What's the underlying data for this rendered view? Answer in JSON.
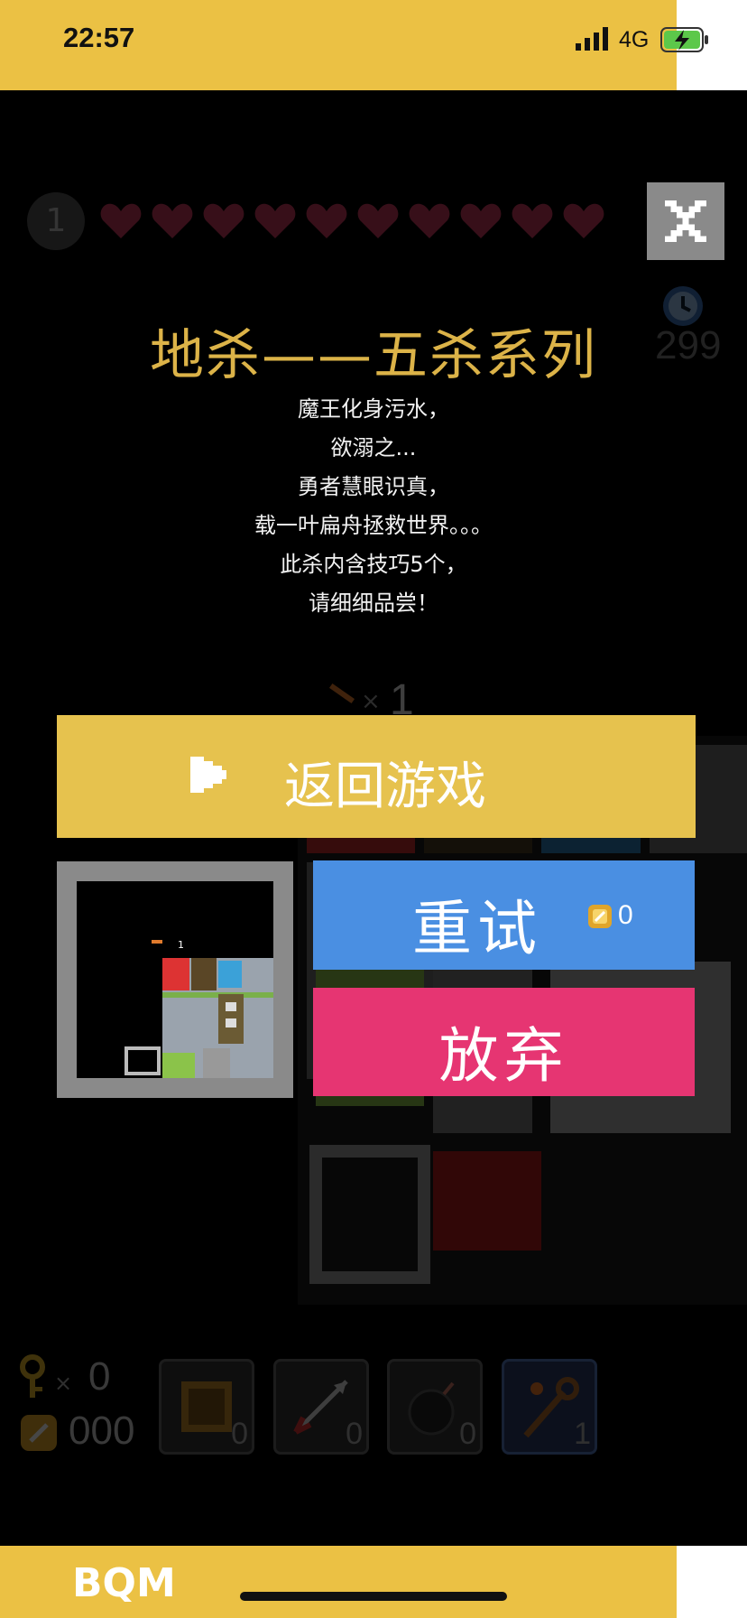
{
  "status_bar": {
    "time": "22:57",
    "network": "4G",
    "bg_color": "#ebc144"
  },
  "hud": {
    "level": "1",
    "hearts": 10,
    "timer": "299"
  },
  "dialog": {
    "title": "地杀——五杀系列",
    "story_lines": [
      "魔王化身污水，",
      "欲溺之...",
      "勇者慧眼识真，",
      "载一叶扁舟拯救世界。。。",
      "此杀内含技巧5个，",
      "请细细品尝！"
    ],
    "return_label": "返回游戏",
    "retry_label": "重试",
    "retry_cost": "0",
    "giveup_label": "放弃",
    "colors": {
      "return": "#e6c24e",
      "retry": "#4a8fe2",
      "giveup": "#e63572",
      "title": "#dcb348"
    }
  },
  "tool_indicator": {
    "count": "1"
  },
  "minimap": {
    "tool_count": "1"
  },
  "inventory": {
    "keys": "0",
    "coins": "000",
    "slots": [
      {
        "name": "crate",
        "count": "0"
      },
      {
        "name": "arrow",
        "count": "0"
      },
      {
        "name": "bomb",
        "count": "0"
      },
      {
        "name": "magic-staff",
        "count": "1"
      }
    ]
  },
  "bottom_bar": {
    "logo": "BQM"
  }
}
